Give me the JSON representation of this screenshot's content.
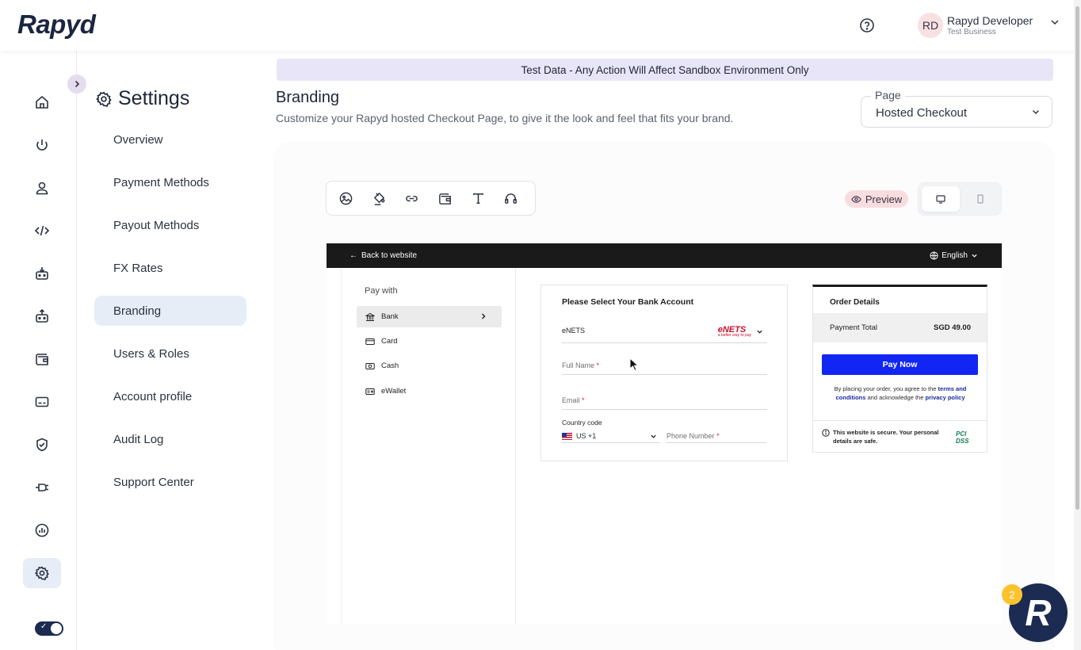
{
  "header": {
    "logo": "Rapyd",
    "help_icon": "help-circle-icon",
    "user": {
      "initials": "RD",
      "name": "Rapyd Developer",
      "business": "Test Business"
    }
  },
  "rail": {
    "items": [
      "home-icon",
      "power-icon",
      "user-icon",
      "code-icon",
      "collect-icon",
      "disburse-icon",
      "wallet-icon",
      "card-icon",
      "shield-check-icon",
      "plug-icon",
      "reports-icon",
      "gear-icon"
    ],
    "active_index": 11
  },
  "settings": {
    "title": "Settings",
    "items": [
      {
        "label": "Overview"
      },
      {
        "label": "Payment Methods"
      },
      {
        "label": "Payout Methods"
      },
      {
        "label": "FX Rates"
      },
      {
        "label": "Branding",
        "active": true
      },
      {
        "label": "Users & Roles"
      },
      {
        "label": "Account profile"
      },
      {
        "label": "Audit Log"
      },
      {
        "label": "Support Center"
      }
    ]
  },
  "banner": "Test Data - Any Action Will Affect Sandbox Environment Only",
  "page": {
    "title": "Branding",
    "subtitle": "Customize your Rapyd hosted Checkout Page, to give it the look and feel that fits your brand.",
    "select_label": "Page",
    "select_value": "Hosted Checkout"
  },
  "toolbar": {
    "tools": [
      "image-icon",
      "paint-bucket-icon",
      "link-icon",
      "wallet-icon",
      "text-icon",
      "headset-icon"
    ]
  },
  "preview": {
    "badge": "Preview",
    "devices": [
      "desktop-icon",
      "mobile-icon"
    ],
    "active_device": "desktop"
  },
  "checkout": {
    "back_label": "Back to website",
    "language": "English",
    "pay_with": "Pay with",
    "methods": [
      {
        "label": "Bank",
        "icon": "bank-icon",
        "active": true
      },
      {
        "label": "Card",
        "icon": "card-icon"
      },
      {
        "label": "Cash",
        "icon": "cash-icon"
      },
      {
        "label": "eWallet",
        "icon": "ewallet-icon"
      }
    ],
    "form": {
      "title": "Please Select Your Bank Account",
      "bank_value": "eNETS",
      "bank_logo": "eNETS",
      "bank_tagline": "a better way to pay",
      "full_name_label": "Full Name",
      "email_label": "Email",
      "required_mark": "*",
      "country_code_label": "Country code",
      "country_code_value": "US +1",
      "phone_label": "Phone Number"
    },
    "order": {
      "title": "Order Details",
      "total_label": "Payment Total",
      "total_value": "SGD 49.00",
      "pay_button": "Pay Now",
      "agree_prefix": "By placing your order, you agree to the",
      "terms_link": "terms and conditions",
      "agree_middle": "and acknowledge the",
      "privacy_link": "privacy policy",
      "secure_text": "This website is secure. Your personal details are safe.",
      "pci_logo": "PCI DSS"
    }
  },
  "chat": {
    "logo": "R",
    "badge_count": "2"
  },
  "colors": {
    "brand_navy": "#1b2b52",
    "active_bg": "#e6edf7",
    "banner_bg": "#e9e5f8",
    "pay_button": "#1226f3",
    "preview_badge": "#f8dde0"
  }
}
